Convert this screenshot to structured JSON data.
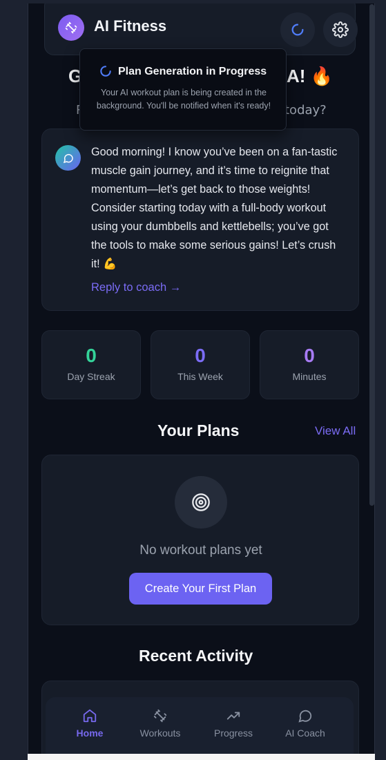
{
  "app": {
    "title": "AI Fitness"
  },
  "greeting": {
    "left": "G",
    "right": "A! 🔥",
    "sub_left": "R",
    "sub_right": "today?"
  },
  "tooltip": {
    "title": "Plan Generation in Progress",
    "body": "Your AI workout plan is being created in the background. You'll be notified when it's ready!"
  },
  "coach": {
    "message": "Good morning! I know you’ve been on a fan-tastic muscle gain journey, and it’s time to reignite that momentum—let’s get back to those weights! Consider starting today with a full-body workout using your dumbbells and kettlebells; you’ve got the tools to make some serious gains! Let’s crush it! 💪",
    "reply_label": "Reply to coach →"
  },
  "stats": [
    {
      "value": "0",
      "label": "Day Streak",
      "color": "#34d399"
    },
    {
      "value": "0",
      "label": "This Week",
      "color": "#7b6cf5"
    },
    {
      "value": "0",
      "label": "Minutes",
      "color": "#a77bf3"
    }
  ],
  "plans": {
    "title": "Your Plans",
    "view_all": "View All",
    "empty_text": "No workout plans yet",
    "create_label": "Create Your First Plan"
  },
  "activity": {
    "title": "Recent Activity"
  },
  "nav": [
    {
      "label": "Home",
      "icon": "home-icon",
      "active": true
    },
    {
      "label": "Workouts",
      "icon": "dumbbell-icon",
      "active": false
    },
    {
      "label": "Progress",
      "icon": "trending-up-icon",
      "active": false
    },
    {
      "label": "AI Coach",
      "icon": "chat-bubble-icon",
      "active": false
    }
  ],
  "colors": {
    "accent": "#6c63f2",
    "background": "#0b0f19",
    "card": "#161c28"
  }
}
